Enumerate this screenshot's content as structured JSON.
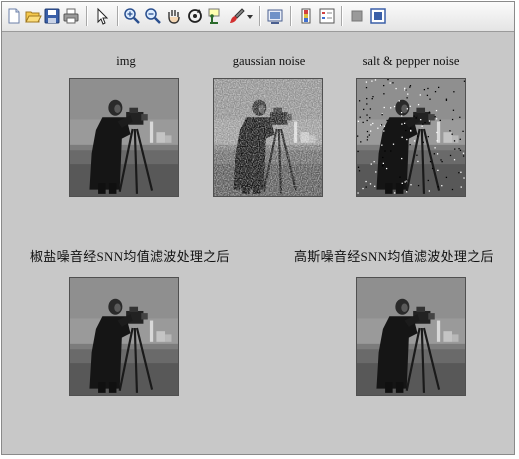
{
  "toolbar": {
    "icons": [
      "new-figure-icon",
      "open-file-icon",
      "save-icon",
      "print-icon",
      "pointer-icon",
      "zoom-in-icon",
      "zoom-out-icon",
      "pan-icon",
      "rotate-3d-icon",
      "data-cursor-icon",
      "brush-icon",
      "brush-dropdown-icon",
      "link-plot-icon",
      "colorbar-icon",
      "legend-icon",
      "hide-plot-tools-icon",
      "show-plot-tools-icon"
    ]
  },
  "figure": {
    "background": "#c8c8c8",
    "subplots": [
      {
        "title": "img",
        "image": "cameraman-original"
      },
      {
        "title": "gaussian noise",
        "image": "cameraman-gaussian-noise"
      },
      {
        "title": "salt & pepper noise",
        "image": "cameraman-salt-pepper-noise"
      },
      {
        "title": "椒盐噪音经SNN均值滤波处理之后",
        "image": "cameraman-snn-filtered-salt-pepper"
      },
      {
        "title": "高斯噪音经SNN均值滤波处理之后",
        "image": "cameraman-snn-filtered-gaussian"
      }
    ]
  }
}
